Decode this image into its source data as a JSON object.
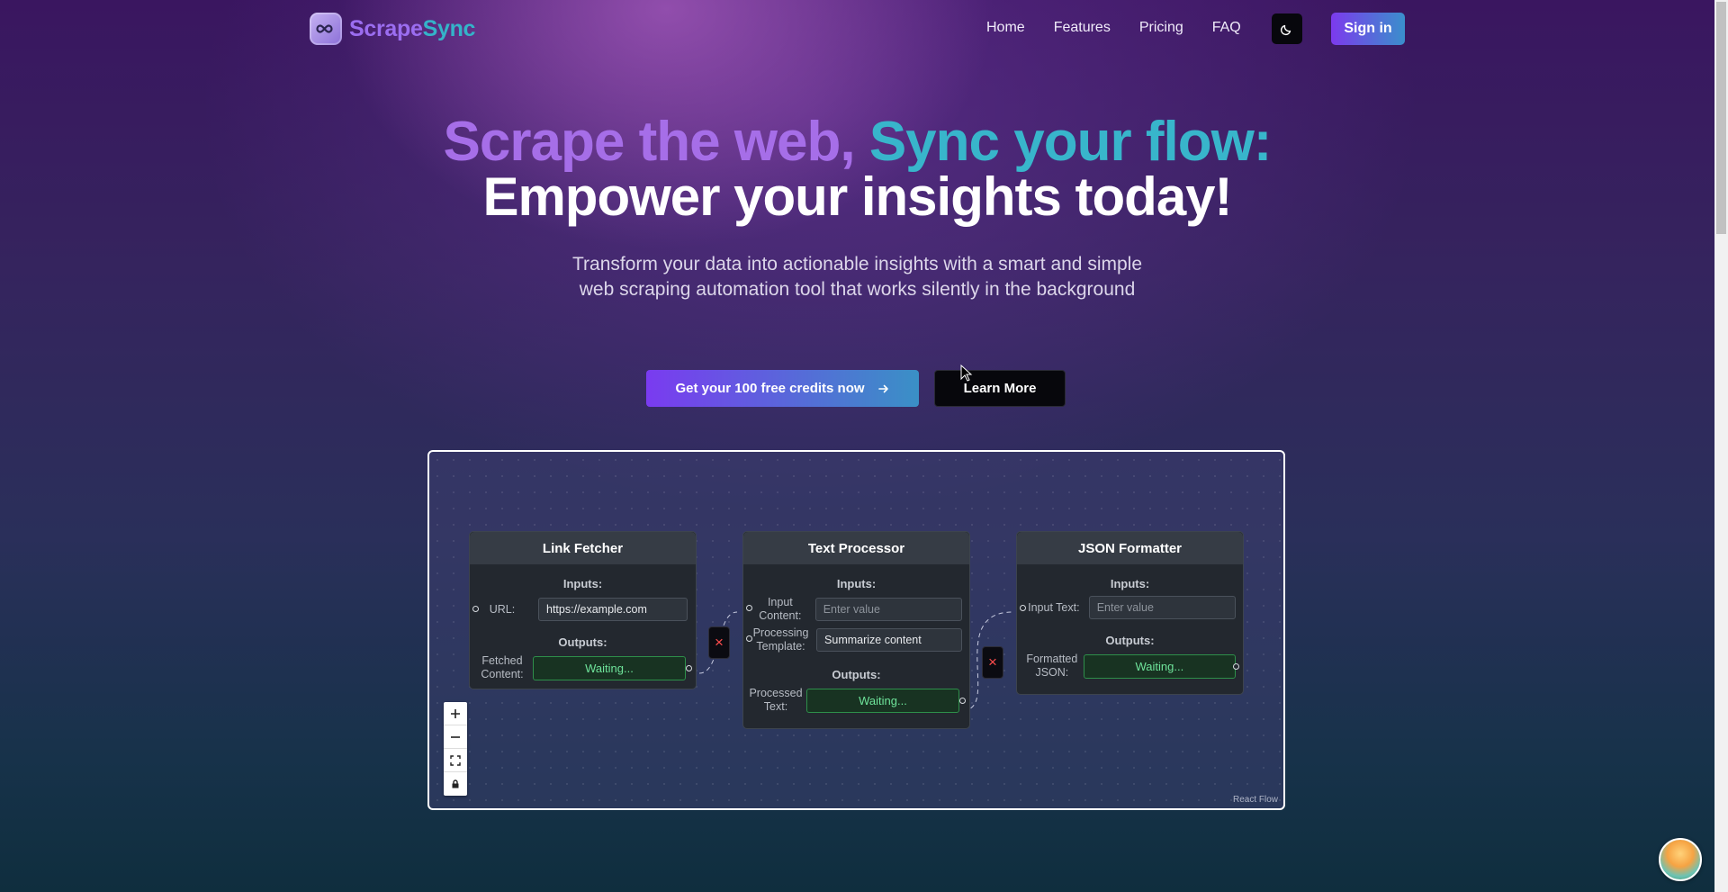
{
  "nav": {
    "brand_part1": "Scrape",
    "brand_part2": "Sync",
    "links": [
      "Home",
      "Features",
      "Pricing",
      "FAQ"
    ],
    "signin_label": "Sign in",
    "theme_icon": "moon-icon"
  },
  "hero": {
    "title_part1": "Scrape the web, ",
    "title_part2": "Sync your flow:",
    "title_line2": "Empower your insights today!",
    "subtitle": "Transform your data into actionable insights with a smart and simple web scraping automation tool that works silently in the background",
    "cta_label": "Get your 100 free credits now",
    "learn_label": "Learn More"
  },
  "flow": {
    "nodes": [
      {
        "title": "Link Fetcher",
        "inputs_label": "Inputs:",
        "outputs_label": "Outputs:",
        "input_label": "URL:",
        "input_value": "https://example.com",
        "output_label": "Fetched Content:",
        "output_status": "Waiting..."
      },
      {
        "title": "Text Processor",
        "inputs_label": "Inputs:",
        "outputs_label": "Outputs:",
        "input1_label": "Input Content:",
        "input1_placeholder": "Enter value",
        "input2_label": "Processing Template:",
        "input2_value": "Summarize content",
        "output_label": "Processed Text:",
        "output_status": "Waiting..."
      },
      {
        "title": "JSON Formatter",
        "inputs_label": "Inputs:",
        "outputs_label": "Outputs:",
        "input_label": "Input Text:",
        "input_placeholder": "Enter value",
        "output_label": "Formatted JSON:",
        "output_status": "Waiting..."
      }
    ],
    "edge_delete_icon": "×",
    "attribution": "React Flow"
  },
  "colors": {
    "accent_purple": "#7c3aed",
    "accent_teal": "#38b5cb",
    "status_green": "#6ee39a"
  }
}
